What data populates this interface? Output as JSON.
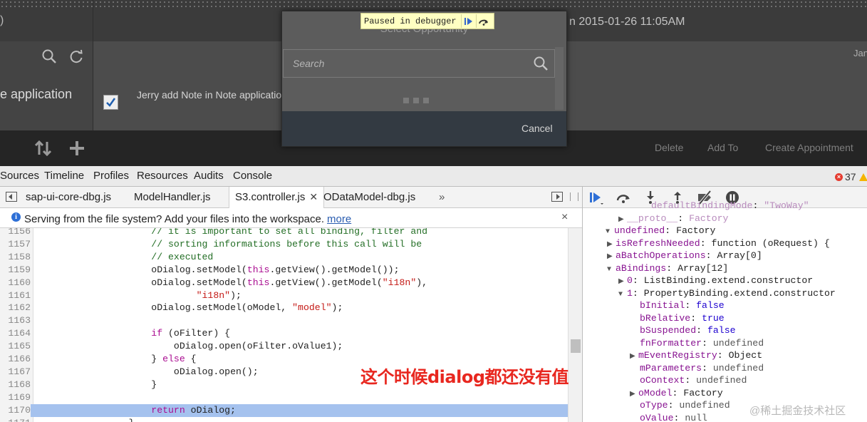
{
  "app": {
    "left_paren": ")",
    "date_text": "n 2015-01-26 11:05AM",
    "app_name_fragment": "e application",
    "note_text": "Jerry add Note in Note applicatio",
    "jan_label": "Jan",
    "footer_buttons": [
      "Delete",
      "Add To",
      "Create Appointment"
    ],
    "icons": [
      "search-icon",
      "refresh-icon",
      "sort-icon",
      "plus-icon",
      "checkbox-checked-icon"
    ]
  },
  "dialog": {
    "title": "Select Opportunity",
    "search_placeholder": "Search",
    "cancel_label": "Cancel"
  },
  "paused_overlay": {
    "text": "Paused in debugger",
    "resume_icon": "resume-icon",
    "step_over_icon": "step-over-icon"
  },
  "devtools": {
    "tabs": [
      "Sources",
      "Timeline",
      "Profiles",
      "Resources",
      "Audits",
      "Console"
    ],
    "error_count": "37",
    "file_tabs": [
      "sap-ui-core-dbg.js",
      "ModelHandler.js",
      "S3.controller.js",
      "ODataModel-dbg.js"
    ],
    "active_file_tab": "S3.controller.js",
    "more_tabs_label": "»",
    "infobar": {
      "text": "Serving from the file system? Add your files into the workspace.",
      "link": "more",
      "close": "×"
    },
    "code_lines": [
      {
        "n": "1156",
        "t": "                            // it is important to set all binding, filter and"
      },
      {
        "n": "1157",
        "t": "                            // sorting informations before this call will be"
      },
      {
        "n": "1158",
        "t": "                            // executed"
      },
      {
        "n": "1159",
        "t": "                            oDialog.setModel(this.getView().getModel());"
      },
      {
        "n": "1160",
        "t": "                            oDialog.setModel(this.getView().getModel(\"i18n\"),"
      },
      {
        "n": "1161",
        "t": "                                    \"i18n\");"
      },
      {
        "n": "1162",
        "t": "                            oDialog.setModel(oModel, \"model\");"
      },
      {
        "n": "1163",
        "t": ""
      },
      {
        "n": "1164",
        "t": "                            if (oFilter) {"
      },
      {
        "n": "1165",
        "t": "                                oDialog.open(oFilter.oValue1);"
      },
      {
        "n": "1166",
        "t": "                            } else {"
      },
      {
        "n": "1167",
        "t": "                                oDialog.open();"
      },
      {
        "n": "1168",
        "t": "                            }"
      },
      {
        "n": "1169",
        "t": ""
      },
      {
        "n": "1170",
        "t": "                            return oDialog;"
      },
      {
        "n": "1171",
        "t": "                        }"
      }
    ],
    "highlighted_line": "1170",
    "annotation": "这个时候dialog都还没有值",
    "scope_tree": [
      {
        "indent": 4,
        "tri": "",
        "k": "defaultBindingMode",
        "v": "\"TwoWay\"",
        "vt": "str",
        "faded": true
      },
      {
        "indent": 2,
        "tri": "▶",
        "k": "__proto__",
        "v": "Factory",
        "vt": "obj",
        "faded": true
      },
      {
        "indent": 0,
        "tri": "▼",
        "k": "undefined",
        "v": "Factory",
        "vt": "obj"
      },
      {
        "indent": 1,
        "tri": "▶",
        "k": "isRefreshNeeded",
        "v": "function (oRequest) {",
        "vt": "obj"
      },
      {
        "indent": 1,
        "tri": "▶",
        "k": "aBatchOperations",
        "v": "Array[0]",
        "vt": "obj"
      },
      {
        "indent": 1,
        "tri": "▼",
        "k": "aBindings",
        "v": "Array[12]",
        "vt": "obj"
      },
      {
        "indent": 2,
        "tri": "▶",
        "k": "0",
        "v": "ListBinding.extend.constructor",
        "vt": "obj"
      },
      {
        "indent": 2,
        "tri": "▼",
        "k": "1",
        "v": "PropertyBinding.extend.constructor",
        "vt": "obj"
      },
      {
        "indent": 3,
        "tri": "",
        "k": "bInitial",
        "v": "false",
        "vt": "bool"
      },
      {
        "indent": 3,
        "tri": "",
        "k": "bRelative",
        "v": "true",
        "vt": "bool"
      },
      {
        "indent": 3,
        "tri": "",
        "k": "bSuspended",
        "v": "false",
        "vt": "bool"
      },
      {
        "indent": 3,
        "tri": "",
        "k": "fnFormatter",
        "v": "undefined",
        "vt": "undef"
      },
      {
        "indent": 3,
        "tri": "▶",
        "k": "mEventRegistry",
        "v": "Object",
        "vt": "obj"
      },
      {
        "indent": 3,
        "tri": "",
        "k": "mParameters",
        "v": "undefined",
        "vt": "undef"
      },
      {
        "indent": 3,
        "tri": "",
        "k": "oContext",
        "v": "undefined",
        "vt": "undef"
      },
      {
        "indent": 3,
        "tri": "▶",
        "k": "oModel",
        "v": "Factory",
        "vt": "obj"
      },
      {
        "indent": 3,
        "tri": "",
        "k": "oType",
        "v": "undefined",
        "vt": "undef"
      },
      {
        "indent": 3,
        "tri": "",
        "k": "oValue",
        "v": "null",
        "vt": "undef"
      }
    ],
    "debugger_buttons": [
      "resume-icon",
      "step-over-icon",
      "step-into-icon",
      "step-out-icon",
      "deactivate-breakpoints-icon",
      "pause-on-exceptions-icon"
    ]
  },
  "watermark": "@稀土掘金技术社区",
  "colors": {
    "highlight": "#a5c2ee",
    "annotation": "#e8271f",
    "error": "#e53b2f"
  }
}
